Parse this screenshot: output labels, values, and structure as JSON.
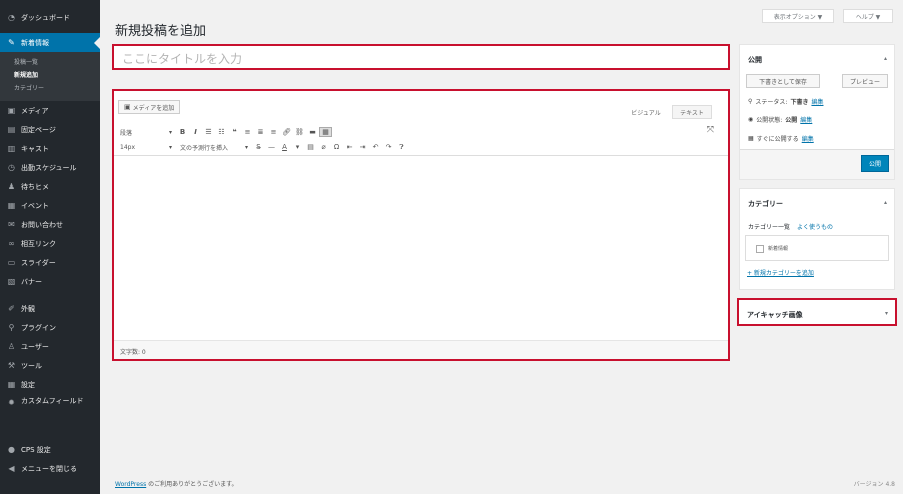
{
  "sidebar": {
    "items": [
      {
        "label": "ダッシュボード",
        "icon": "dashboard-icon"
      },
      {
        "label": "新着情報",
        "icon": "pin-icon"
      }
    ],
    "submenu": [
      "投稿一覧",
      "新規追加",
      "カテゴリー"
    ],
    "items2": [
      {
        "label": "メディア",
        "icon": "media-icon"
      },
      {
        "label": "固定ページ",
        "icon": "page-icon"
      },
      {
        "label": "キャスト",
        "icon": "cast-icon"
      },
      {
        "label": "出勤スケジュール",
        "icon": "clock-icon"
      },
      {
        "label": "待ちヒメ",
        "icon": "users-icon"
      },
      {
        "label": "イベント",
        "icon": "calendar-icon"
      },
      {
        "label": "お問い合わせ",
        "icon": "mail-icon"
      },
      {
        "label": "相互リンク",
        "icon": "link-icon"
      },
      {
        "label": "スライダー",
        "icon": "slider-icon"
      },
      {
        "label": "バナー",
        "icon": "banner-icon"
      }
    ],
    "items3": [
      {
        "label": "外観",
        "icon": "brush-icon"
      },
      {
        "label": "プラグイン",
        "icon": "plugin-icon"
      },
      {
        "label": "ユーザー",
        "icon": "user-icon"
      },
      {
        "label": "ツール",
        "icon": "wrench-icon"
      },
      {
        "label": "設定",
        "icon": "settings-icon"
      },
      {
        "label": "カスタムフィールド",
        "icon": "gear-icon"
      }
    ],
    "items4": [
      {
        "label": "CPS 設定",
        "icon": "cps-icon"
      },
      {
        "label": "メニューを閉じる",
        "icon": "collapse-icon"
      }
    ]
  },
  "header": {
    "screen_options": "表示オプション ▼",
    "help": "ヘルプ ▼",
    "page_title": "新規投稿を追加"
  },
  "title_input": {
    "placeholder": "ここにタイトルを入力"
  },
  "editor": {
    "add_media": "メディアを追加",
    "tab_visual": "ビジュアル",
    "tab_text": "テキスト",
    "format_select": "段落",
    "size_select": "14px",
    "template_select": "文の予測行を挿入",
    "word_count": "文字数: 0"
  },
  "publish": {
    "title": "公開",
    "save_draft": "下書きとして保存",
    "preview": "プレビュー",
    "status_label": "ステータス:",
    "status_value": "下書き",
    "visibility_label": "公開状態:",
    "visibility_value": "公開",
    "schedule_label": "すぐに公開する",
    "edit": "編集",
    "publish_button": "公開"
  },
  "category": {
    "title": "カテゴリー",
    "tab_all": "カテゴリー一覧",
    "tab_popular": "よく使うもの",
    "item": "新着情報",
    "add_new": "+ 新規カテゴリーを追加"
  },
  "featured": {
    "title": "アイキャッチ画像"
  },
  "footer": {
    "left_link": "WordPress",
    "left_text": " のご利用ありがとうございます。",
    "right": "バージョン 4.8"
  },
  "colors": {
    "accent": "#0073aa",
    "highlight_border": "#c8102e",
    "sidebar_bg": "#23282d"
  }
}
